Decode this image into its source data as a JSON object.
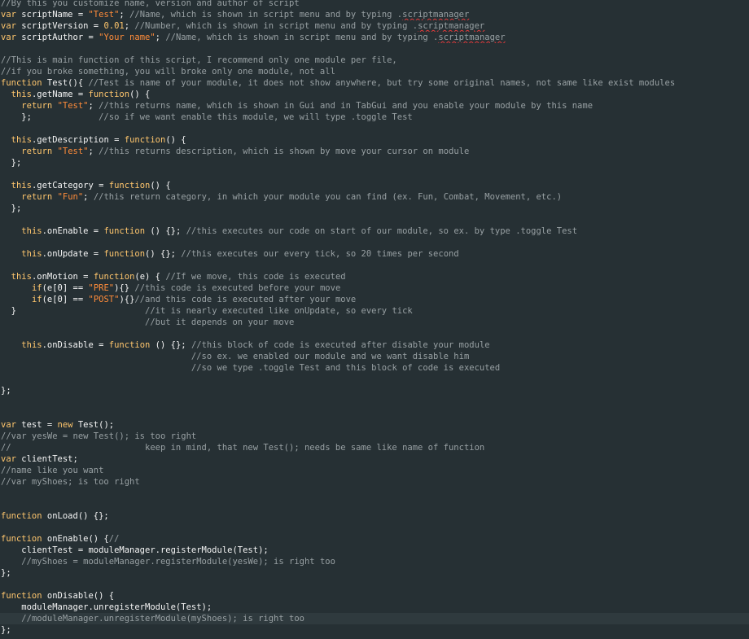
{
  "editor": {
    "language": "javascript",
    "theme": {
      "background": "#263034",
      "current_line": "#2f3a3e",
      "keyword": "#ffc66d",
      "string": "#ff8c3a",
      "comment": "#98a0a3",
      "identifier": "#f5f5f5"
    },
    "lines": [
      {
        "tokens": [
          {
            "t": "cm",
            "v": "//By this you customize name, version and author of script"
          }
        ]
      },
      {
        "tokens": [
          {
            "t": "kw",
            "v": "var"
          },
          {
            "t": "id",
            "v": " scriptName = "
          },
          {
            "t": "str",
            "v": "\"Test\""
          },
          {
            "t": "pu",
            "v": "; "
          },
          {
            "t": "cm",
            "v": "//Name, which is shown in script menu and by typing ."
          },
          {
            "t": "cm",
            "v": "scriptmanager",
            "e": 1
          }
        ]
      },
      {
        "tokens": [
          {
            "t": "kw",
            "v": "var"
          },
          {
            "t": "id",
            "v": " scriptVersion = "
          },
          {
            "t": "num",
            "v": "0.01"
          },
          {
            "t": "pu",
            "v": "; "
          },
          {
            "t": "cm",
            "v": "//Number, which is shown in script menu and by typing ."
          },
          {
            "t": "cm",
            "v": "scriptmanager",
            "e": 1
          }
        ]
      },
      {
        "tokens": [
          {
            "t": "kw",
            "v": "var"
          },
          {
            "t": "id",
            "v": " scriptAuthor = "
          },
          {
            "t": "str",
            "v": "\"Your name\""
          },
          {
            "t": "pu",
            "v": "; "
          },
          {
            "t": "cm",
            "v": "//Name, which is shown in script menu and by typing ."
          },
          {
            "t": "cm",
            "v": "scriptmanager",
            "e": 1
          }
        ]
      },
      {
        "tokens": []
      },
      {
        "tokens": [
          {
            "t": "cm",
            "v": "//This is main function of this script, I recommend only one module per file,"
          }
        ]
      },
      {
        "tokens": [
          {
            "t": "cm",
            "v": "//if you broke something, you will broke only one module, not all"
          }
        ]
      },
      {
        "tokens": [
          {
            "t": "kw",
            "v": "function"
          },
          {
            "t": "id",
            "v": " Test(){ "
          },
          {
            "t": "cm",
            "v": "//Test is name of your module, it does not show anywhere, but try some original names, not same like exist modules"
          }
        ]
      },
      {
        "tokens": [
          {
            "t": "id",
            "v": "  "
          },
          {
            "t": "bi",
            "v": "this"
          },
          {
            "t": "id",
            "v": ".getName = "
          },
          {
            "t": "kw",
            "v": "function"
          },
          {
            "t": "id",
            "v": "() {"
          }
        ]
      },
      {
        "tokens": [
          {
            "t": "id",
            "v": "    "
          },
          {
            "t": "kw",
            "v": "return"
          },
          {
            "t": "id",
            "v": " "
          },
          {
            "t": "str",
            "v": "\"Test\""
          },
          {
            "t": "pu",
            "v": "; "
          },
          {
            "t": "cm",
            "v": "//this returns name, which is shown in Gui and in TabGui and you enable your module by this name"
          }
        ]
      },
      {
        "tokens": [
          {
            "t": "id",
            "v": "    };             "
          },
          {
            "t": "cm",
            "v": "//so if we want enable this module, we will type .toggle Test"
          }
        ]
      },
      {
        "tokens": []
      },
      {
        "tokens": [
          {
            "t": "id",
            "v": "  "
          },
          {
            "t": "bi",
            "v": "this"
          },
          {
            "t": "id",
            "v": ".getDescription = "
          },
          {
            "t": "kw",
            "v": "function"
          },
          {
            "t": "id",
            "v": "() {"
          }
        ]
      },
      {
        "tokens": [
          {
            "t": "id",
            "v": "    "
          },
          {
            "t": "kw",
            "v": "return"
          },
          {
            "t": "id",
            "v": " "
          },
          {
            "t": "str",
            "v": "\"Test\""
          },
          {
            "t": "pu",
            "v": "; "
          },
          {
            "t": "cm",
            "v": "//this returns description, which is shown by move your cursor on module"
          }
        ]
      },
      {
        "tokens": [
          {
            "t": "id",
            "v": "  };"
          }
        ]
      },
      {
        "tokens": []
      },
      {
        "tokens": [
          {
            "t": "id",
            "v": "  "
          },
          {
            "t": "bi",
            "v": "this"
          },
          {
            "t": "id",
            "v": ".getCategory = "
          },
          {
            "t": "kw",
            "v": "function"
          },
          {
            "t": "id",
            "v": "() {"
          }
        ]
      },
      {
        "tokens": [
          {
            "t": "id",
            "v": "    "
          },
          {
            "t": "kw",
            "v": "return"
          },
          {
            "t": "id",
            "v": " "
          },
          {
            "t": "str",
            "v": "\"Fun\""
          },
          {
            "t": "pu",
            "v": "; "
          },
          {
            "t": "cm",
            "v": "//this return category, in which your module you can find (ex. Fun, Combat, Movement, etc.)"
          }
        ]
      },
      {
        "tokens": [
          {
            "t": "id",
            "v": "  };"
          }
        ]
      },
      {
        "tokens": []
      },
      {
        "tokens": [
          {
            "t": "id",
            "v": "    "
          },
          {
            "t": "bi",
            "v": "this"
          },
          {
            "t": "id",
            "v": ".onEnable = "
          },
          {
            "t": "kw",
            "v": "function"
          },
          {
            "t": "id",
            "v": " () {}; "
          },
          {
            "t": "cm",
            "v": "//this executes our code on start of our module, so ex. by type .toggle Test"
          }
        ]
      },
      {
        "tokens": []
      },
      {
        "tokens": [
          {
            "t": "id",
            "v": "    "
          },
          {
            "t": "bi",
            "v": "this"
          },
          {
            "t": "id",
            "v": ".onUpdate = "
          },
          {
            "t": "kw",
            "v": "function"
          },
          {
            "t": "id",
            "v": "() {}; "
          },
          {
            "t": "cm",
            "v": "//this executes our every tick, so 20 times per second"
          }
        ]
      },
      {
        "tokens": []
      },
      {
        "tokens": [
          {
            "t": "id",
            "v": "  "
          },
          {
            "t": "bi",
            "v": "this"
          },
          {
            "t": "id",
            "v": ".onMotion = "
          },
          {
            "t": "kw",
            "v": "function"
          },
          {
            "t": "id",
            "v": "(e) { "
          },
          {
            "t": "cm",
            "v": "//If we move, this code is executed"
          }
        ]
      },
      {
        "tokens": [
          {
            "t": "id",
            "v": "      "
          },
          {
            "t": "kw",
            "v": "if"
          },
          {
            "t": "id",
            "v": "(e[0] == "
          },
          {
            "t": "str",
            "v": "\"PRE\""
          },
          {
            "t": "id",
            "v": "){} "
          },
          {
            "t": "cm",
            "v": "//this code is executed before your move"
          }
        ]
      },
      {
        "tokens": [
          {
            "t": "id",
            "v": "      "
          },
          {
            "t": "kw",
            "v": "if"
          },
          {
            "t": "id",
            "v": "(e[0] == "
          },
          {
            "t": "str",
            "v": "\"POST\""
          },
          {
            "t": "id",
            "v": "){}"
          },
          {
            "t": "cm",
            "v": "//and this code is executed after your move"
          }
        ]
      },
      {
        "tokens": [
          {
            "t": "id",
            "v": "  }                         "
          },
          {
            "t": "cm",
            "v": "//it is nearly executed like onUpdate, so every tick"
          }
        ]
      },
      {
        "tokens": [
          {
            "t": "id",
            "v": "                            "
          },
          {
            "t": "cm",
            "v": "//but it depends on your move"
          }
        ]
      },
      {
        "tokens": []
      },
      {
        "tokens": [
          {
            "t": "id",
            "v": "    "
          },
          {
            "t": "bi",
            "v": "this"
          },
          {
            "t": "id",
            "v": ".onDisable = "
          },
          {
            "t": "kw",
            "v": "function"
          },
          {
            "t": "id",
            "v": " () {}; "
          },
          {
            "t": "cm",
            "v": "//this block of code is executed after disable your module"
          }
        ]
      },
      {
        "tokens": [
          {
            "t": "id",
            "v": "                                     "
          },
          {
            "t": "cm",
            "v": "//so ex. we enabled our module and we want disable him"
          }
        ]
      },
      {
        "tokens": [
          {
            "t": "id",
            "v": "                                     "
          },
          {
            "t": "cm",
            "v": "//so we type .toggle Test and this block of code is executed"
          }
        ]
      },
      {
        "tokens": []
      },
      {
        "tokens": [
          {
            "t": "id",
            "v": "};"
          }
        ]
      },
      {
        "tokens": []
      },
      {
        "tokens": []
      },
      {
        "tokens": [
          {
            "t": "kw",
            "v": "var"
          },
          {
            "t": "id",
            "v": " test = "
          },
          {
            "t": "kw",
            "v": "new"
          },
          {
            "t": "id",
            "v": " Test();"
          }
        ]
      },
      {
        "tokens": [
          {
            "t": "cm",
            "v": "//var yesWe = new Test(); is too right"
          }
        ]
      },
      {
        "tokens": [
          {
            "t": "cm",
            "v": "//                          keep in mind, that new Test(); needs be same like name of function"
          }
        ]
      },
      {
        "tokens": [
          {
            "t": "kw",
            "v": "var"
          },
          {
            "t": "id",
            "v": " clientTest;"
          }
        ]
      },
      {
        "tokens": [
          {
            "t": "cm",
            "v": "//name like you want"
          }
        ]
      },
      {
        "tokens": [
          {
            "t": "cm",
            "v": "//var myShoes; is too right"
          }
        ]
      },
      {
        "tokens": []
      },
      {
        "tokens": []
      },
      {
        "tokens": [
          {
            "t": "kw",
            "v": "function"
          },
          {
            "t": "id",
            "v": " onLoad() {};"
          }
        ]
      },
      {
        "tokens": []
      },
      {
        "tokens": [
          {
            "t": "kw",
            "v": "function"
          },
          {
            "t": "id",
            "v": " onEnable() {"
          },
          {
            "t": "cm",
            "v": "//"
          }
        ]
      },
      {
        "tokens": [
          {
            "t": "id",
            "v": "    clientTest = moduleManager.registerModule(Test);"
          }
        ]
      },
      {
        "tokens": [
          {
            "t": "id",
            "v": "    "
          },
          {
            "t": "cm",
            "v": "//myShoes = moduleManager.registerModule(yesWe); is right too"
          }
        ]
      },
      {
        "tokens": [
          {
            "t": "id",
            "v": "};"
          }
        ]
      },
      {
        "tokens": []
      },
      {
        "tokens": [
          {
            "t": "kw",
            "v": "function"
          },
          {
            "t": "id",
            "v": " onDisable() {"
          }
        ]
      },
      {
        "tokens": [
          {
            "t": "id",
            "v": "    moduleManager.unregisterModule(Test);"
          }
        ]
      },
      {
        "tokens": [
          {
            "t": "id",
            "v": "    "
          },
          {
            "t": "cm",
            "v": "//moduleManager.unregisterModule(myShoes); is right too"
          }
        ],
        "current": true
      },
      {
        "tokens": [
          {
            "t": "id",
            "v": "};"
          }
        ]
      }
    ]
  }
}
